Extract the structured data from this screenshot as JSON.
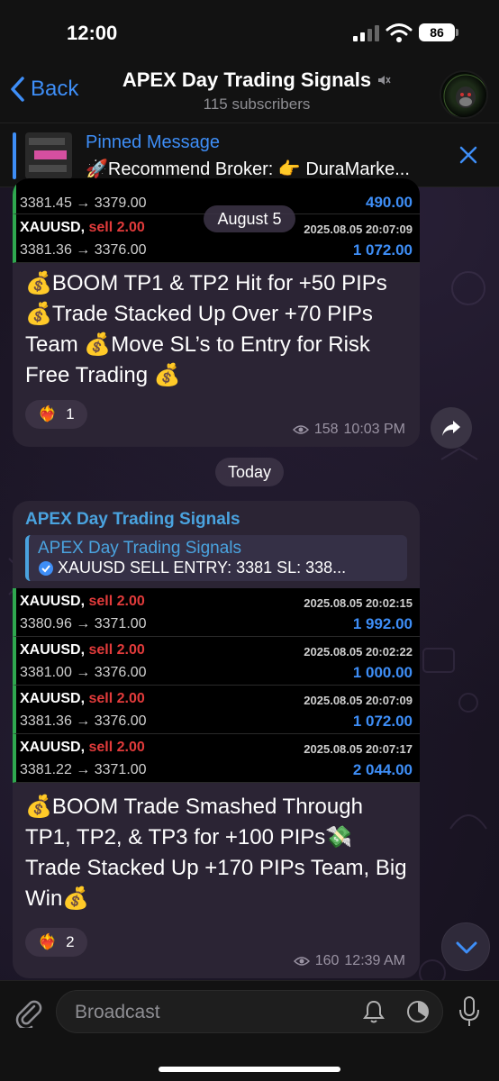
{
  "status_bar": {
    "time": "12:00",
    "battery": "86"
  },
  "nav": {
    "back_label": "Back",
    "title": "APEX Day Trading Signals",
    "subtitle": "115 subscribers"
  },
  "pinned": {
    "title": "Pinned Message",
    "text": "🚀Recommend Broker: 👉 DuraMarke..."
  },
  "message1": {
    "partial_rows": [
      {
        "symbol": "",
        "side": "",
        "date": "",
        "prices": "3381.45 → 3379.00",
        "profit": "490.00"
      },
      {
        "symbol": "XAUUSD,",
        "side": "sell 2.00",
        "date": "2025.08.05 20:07:09",
        "prices": "3381.36 → 3376.00",
        "profit": "1 072.00"
      }
    ],
    "text": "💰BOOM TP1 & TP2 Hit for +50 PIPs 💰Trade Stacked Up Over +70 PIPs Team 💰Move SL’s to Entry for Risk Free Trading 💰",
    "reaction_emoji": "❤️‍🔥",
    "reaction_count": "1",
    "views": "158",
    "time": "10:03 PM"
  },
  "date_pills": {
    "first": "August 5",
    "second": "Today"
  },
  "message2": {
    "sender": "APEX Day Trading Signals",
    "reply_title": "APEX Day Trading Signals",
    "reply_text": "XAUUSD SELL ENTRY: 3381 SL: 338...",
    "rows": [
      {
        "symbol": "XAUUSD,",
        "side": "sell 2.00",
        "date": "2025.08.05 20:02:15",
        "prices": "3380.96 → 3371.00",
        "profit": "1 992.00"
      },
      {
        "symbol": "XAUUSD,",
        "side": "sell 2.00",
        "date": "2025.08.05 20:02:22",
        "prices": "3381.00 → 3376.00",
        "profit": "1 000.00"
      },
      {
        "symbol": "XAUUSD,",
        "side": "sell 2.00",
        "date": "2025.08.05 20:07:09",
        "prices": "3381.36 → 3376.00",
        "profit": "1 072.00"
      },
      {
        "symbol": "XAUUSD,",
        "side": "sell 2.00",
        "date": "2025.08.05 20:07:17",
        "prices": "3381.22 → 3371.00",
        "profit": "2 044.00"
      }
    ],
    "text": "💰BOOM Trade Smashed Through TP1, TP2, & TP3 for +100 PIPs💸Trade Stacked Up +170 PIPs Team, Big Win💰",
    "reaction_emoji": "❤️‍🔥",
    "reaction_count": "2",
    "views": "160",
    "time": "12:39 AM"
  },
  "input": {
    "placeholder": "Broadcast"
  },
  "colors": {
    "accent": "#3e8ef7",
    "sell": "#e23b3b",
    "bubble": "#2b2434",
    "row_bar": "#2fa84f"
  }
}
